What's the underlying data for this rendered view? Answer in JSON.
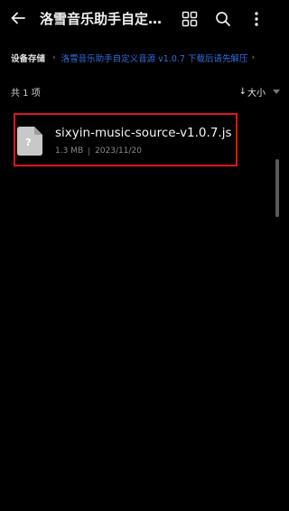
{
  "header": {
    "title": "洛雪音乐助手自定义音源",
    "icons": {
      "back": "back-arrow-icon",
      "grid": "grid-view-icon",
      "search": "search-icon",
      "more": "more-vertical-icon"
    }
  },
  "breadcrumb": {
    "root": "设备存储",
    "current": "洛雪音乐助手自定义音源 v1.0.7 下载后请先解压"
  },
  "list_header": {
    "count": "共 1 项",
    "sort_label": "大小"
  },
  "files": [
    {
      "name": "sixyin-music-source-v1.0.7.js",
      "size": "1.3 MB",
      "date": "2023/11/20",
      "icon": "unknown-file-icon"
    }
  ],
  "colors": {
    "background": "#000000",
    "accent": "#2f6fe0",
    "highlight": "#e0141c",
    "file_icon": "#c8c8c8"
  }
}
